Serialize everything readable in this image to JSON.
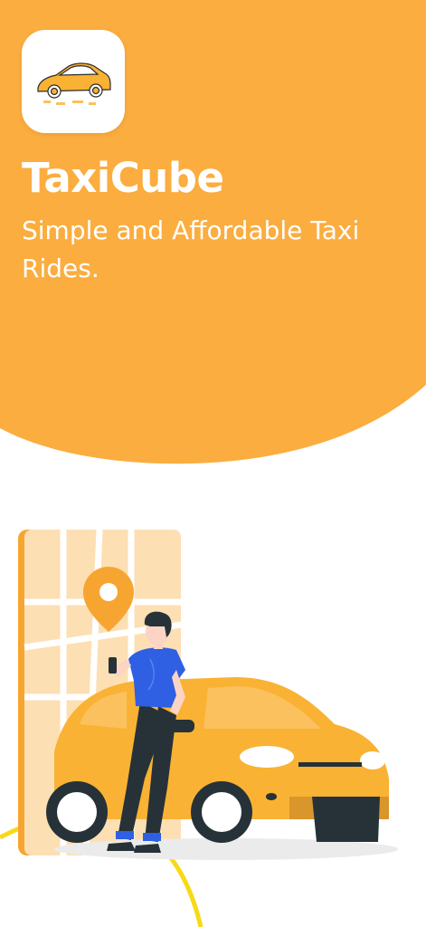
{
  "app": {
    "name": "TaxiCube",
    "tagline": "Simple and Affordable Taxi Rides."
  },
  "icons": {
    "app_icon": "taxi-car-logo",
    "illustration": "person-leaning-on-taxi"
  },
  "colors": {
    "brand_orange": "#FBAD3F",
    "map_bg": "#FDDFB4",
    "car_yellow": "#F9B233",
    "route_yellow": "#F7D917",
    "shirt_blue": "#2F5FE3",
    "dark": "#263238"
  }
}
